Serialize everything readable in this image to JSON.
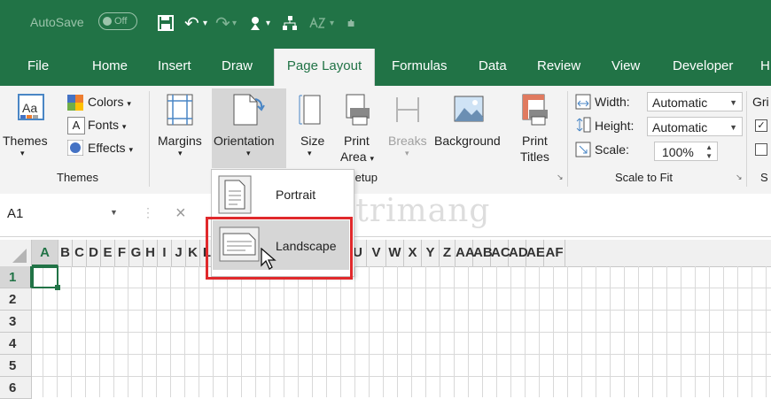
{
  "titlebar": {
    "autosave_label": "AutoSave",
    "autosave_state": "Off",
    "qat_icons": [
      "save-icon",
      "undo-icon",
      "redo-icon",
      "spelling-icon",
      "network-icon",
      "sort-icon",
      "customize-icon"
    ]
  },
  "tabs": [
    "File",
    "Home",
    "Insert",
    "Draw",
    "Page Layout",
    "Formulas",
    "Data",
    "Review",
    "View",
    "Developer",
    "H"
  ],
  "active_tab": "Page Layout",
  "ribbon": {
    "themes": {
      "themes_label": "Themes",
      "colors_label": "Colors",
      "fonts_label": "Fonts",
      "effects_label": "Effects",
      "group_label": "Themes"
    },
    "page_setup": {
      "margins_label": "Margins",
      "orientation_label": "Orientation",
      "size_label": "Size",
      "print_area_label_1": "Print",
      "print_area_label_2": "Area",
      "breaks_label": "Breaks",
      "background_label": "Background",
      "print_titles_label_1": "Print",
      "print_titles_label_2": "Titles",
      "group_label": "Setup"
    },
    "scale_to_fit": {
      "width_label": "Width:",
      "width_value": "Automatic",
      "height_label": "Height:",
      "height_value": "Automatic",
      "scale_label": "Scale:",
      "scale_value": "100%",
      "group_label": "Scale to Fit"
    },
    "sheet_options": {
      "label_1": "Gri",
      "label_2": "S"
    }
  },
  "formula_bar": {
    "name_box": "A1",
    "cancel": "×"
  },
  "orientation_menu": {
    "portrait_label": "Portrait",
    "landscape_label": "Landscape"
  },
  "watermark": "Quantrimang",
  "columns": [
    "A",
    "B",
    "C",
    "D",
    "E",
    "F",
    "G",
    "H",
    "I",
    "J",
    "K",
    "L",
    "M",
    "N",
    "O",
    "P",
    "Q",
    "R",
    "S",
    "T",
    "U",
    "V",
    "W",
    "X",
    "Y",
    "Z",
    "AA",
    "AB",
    "AC",
    "AD",
    "AE",
    "AF"
  ],
  "rows": [
    "1",
    "2",
    "3",
    "4",
    "5",
    "6"
  ],
  "colors": {
    "excel_green": "#217346",
    "highlight_red": "#e0292c"
  }
}
